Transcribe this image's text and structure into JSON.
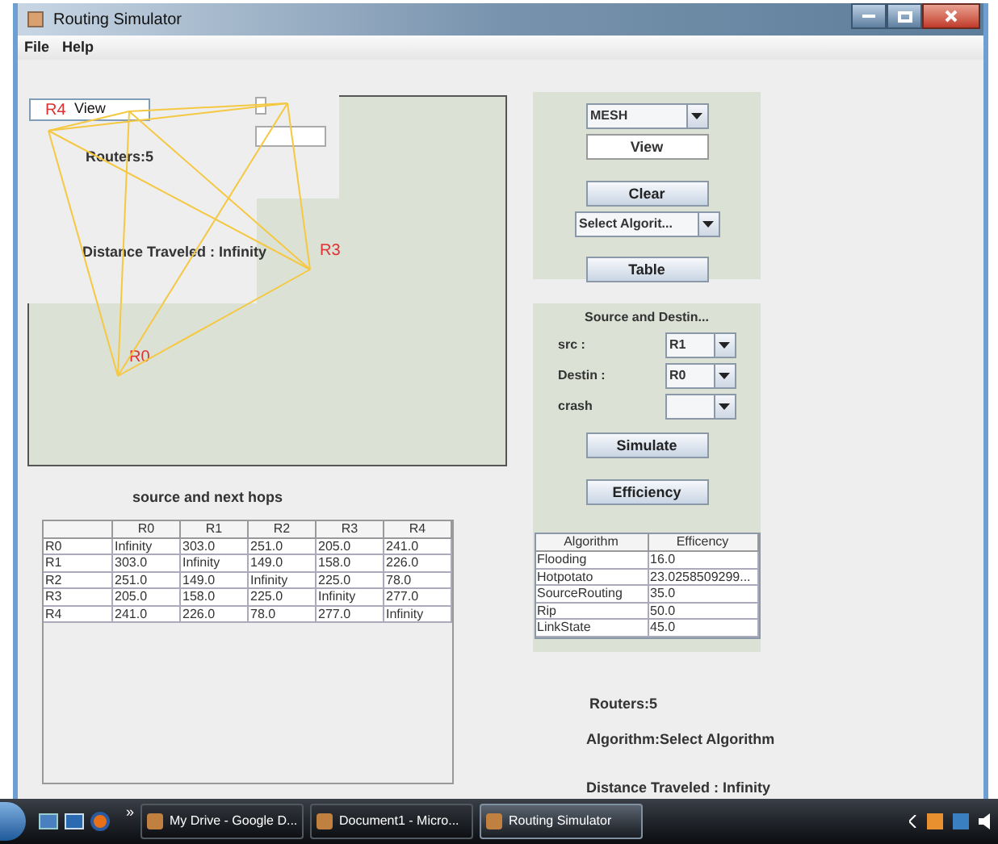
{
  "window": {
    "title": "Routing Simulator"
  },
  "menu": [
    "File",
    "Help"
  ],
  "canvas": {
    "view_field": "View",
    "routers_label": "Routers:5",
    "distance_label": "Distance Traveled : Infinity",
    "nodes": [
      {
        "label": "R4"
      },
      {
        "label": "R3"
      },
      {
        "label": "R0"
      }
    ]
  },
  "topology_panel": {
    "topology_select": "MESH",
    "view_field": "View",
    "clear_button": "Clear",
    "algorithm_select": "Select Algorit...",
    "table_button": "Table"
  },
  "route_panel": {
    "title": "Source and Destin...",
    "fields": [
      {
        "label": "src :",
        "value": "R1"
      },
      {
        "label": "Destin :",
        "value": "R0"
      },
      {
        "label": "crash"
      }
    ],
    "simulate_button": "Simulate",
    "efficiency_button": "Efficiency"
  },
  "hops_table": {
    "title": "source and next hops",
    "columns": [
      "R0",
      "R1",
      "R2",
      "R3",
      "R4"
    ],
    "rows": [
      {
        "name": "R0",
        "cells": [
          "Infinity",
          "303.0",
          "251.0",
          "205.0",
          "241.0"
        ]
      },
      {
        "name": "R1",
        "cells": [
          "303.0",
          "Infinity",
          "149.0",
          "158.0",
          "226.0"
        ]
      },
      {
        "name": "R2",
        "cells": [
          "251.0",
          "149.0",
          "Infinity",
          "225.0",
          "78.0"
        ]
      },
      {
        "name": "R3",
        "cells": [
          "205.0",
          "158.0",
          "225.0",
          "Infinity",
          "277.0"
        ]
      },
      {
        "name": "R4",
        "cells": [
          "241.0",
          "226.0",
          "78.0",
          "277.0",
          "Infinity"
        ]
      }
    ]
  },
  "efficiency_table": {
    "columns": [
      "Algorithm",
      "Efficency"
    ],
    "rows": [
      [
        "Flooding",
        "16.0"
      ],
      [
        "Hotpotato",
        "23.0258509299..."
      ],
      [
        "SourceRouting",
        "35.0"
      ],
      [
        "Rip",
        "50.0"
      ],
      [
        "LinkState",
        "45.0"
      ]
    ]
  },
  "status": {
    "routers": "Routers:5",
    "algorithm": "Algorithm:Select Algorithm",
    "distance": "Distance Traveled : Infinity"
  },
  "taskbar": {
    "overflow": "»",
    "items": [
      {
        "label": "My Drive - Google D...",
        "selected": false
      },
      {
        "label": "Document1 - Micro...",
        "selected": false
      },
      {
        "label": "Routing Simulator",
        "selected": true
      }
    ]
  }
}
